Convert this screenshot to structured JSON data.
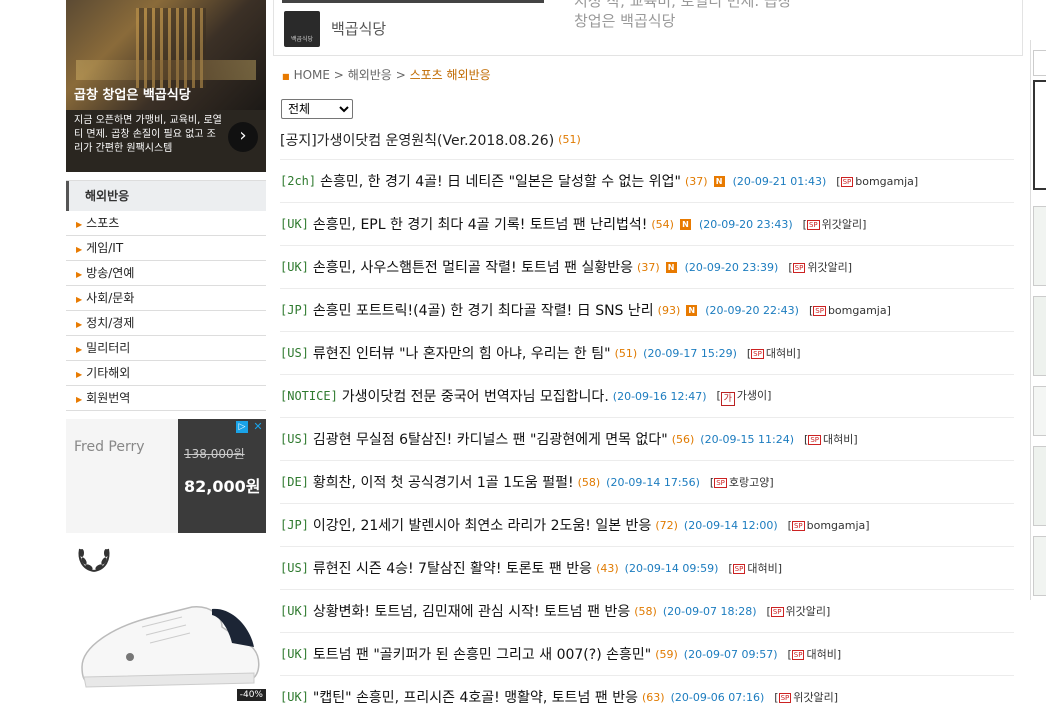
{
  "promo": {
    "title": "곱창 창업은 백곱식당",
    "desc": "지금 오픈하면 가맹비, 교육비, 로열티 면제. 곱창 손질이 필요 없고 조리가 간편한 원팩시스템",
    "arrow": "›"
  },
  "side_nav": {
    "title": "해외반응",
    "items": [
      "스포츠",
      "게임/IT",
      "방송/연예",
      "사회/문화",
      "정치/경제",
      "밀리터리",
      "기타해외",
      "회원번역"
    ]
  },
  "ad": {
    "brand": "Fred Perry",
    "old_price": "138,000원",
    "new_price": "82,000원",
    "discount": "-40%",
    "adchoice": "▷",
    "close": "✕"
  },
  "top_card": {
    "name": "백곱식당",
    "cut_text": "지정 작, 교육비, 로열티 면제. 곱창",
    "sub": "창업은 백곱식당",
    "thumb_label": "백곱식당"
  },
  "breadcrumb": {
    "home": "HOME",
    "sep1": ">",
    "level1": "해외반응",
    "sep2": ">",
    "current": "스포츠 해외반응"
  },
  "filter": {
    "selected": "전체"
  },
  "notice": {
    "title": "[공지]가생이닷컴 운영원칙(Ver.2018.08.26)",
    "count": "(51)"
  },
  "posts": [
    {
      "tag": "[2ch]",
      "title": "손흥민, 한 경기 4골! 日 네티즌 \"일본은 달성할 수 없는 위업\"",
      "count": "(37)",
      "new": true,
      "date": "(20-09-21 01:43)",
      "author": "bomgamja",
      "icon": "sp"
    },
    {
      "tag": "[UK]",
      "title": "손흥민, EPL 한 경기 최다 4골 기록! 토트넘 팬 난리법석!",
      "count": "(54)",
      "new": true,
      "date": "(20-09-20 23:43)",
      "author": "위갓알리",
      "icon": "sp"
    },
    {
      "tag": "[UK]",
      "title": "손흥민, 사우스햄튼전 멀티골 작렬! 토트넘 팬 실황반응",
      "count": "(37)",
      "new": true,
      "date": "(20-09-20 23:39)",
      "author": "위갓알리",
      "icon": "sp"
    },
    {
      "tag": "[JP]",
      "title": "손흥민 포트트릭!(4골) 한 경기 최다골 작렬! 日 SNS 난리",
      "count": "(93)",
      "new": true,
      "date": "(20-09-20 22:43)",
      "author": "bomgamja",
      "icon": "sp"
    },
    {
      "tag": "[US]",
      "title": "류현진 인터뷰 \"나 혼자만의 힘 아냐, 우리는 한 팀\"",
      "count": "(51)",
      "new": false,
      "date": "(20-09-17 15:29)",
      "author": "대혀비",
      "icon": "sp"
    },
    {
      "tag": "[NOTICE]",
      "title": "가생이닷컴 전문 중국어 번역자님 모집합니다.",
      "count": "",
      "new": false,
      "date": "(20-09-16 12:47)",
      "author": "가생이",
      "icon": "g"
    },
    {
      "tag": "[US]",
      "title": "김광현 무실점 6탈삼진! 카디널스 팬 \"김광현에게 면목 없다\"",
      "count": "(56)",
      "new": false,
      "date": "(20-09-15 11:24)",
      "author": "대혀비",
      "icon": "sp"
    },
    {
      "tag": "[DE]",
      "title": "황희찬, 이적 첫 공식경기서 1골 1도움 펄펄!",
      "count": "(58)",
      "new": false,
      "date": "(20-09-14 17:56)",
      "author": "호랑고양",
      "icon": "sp"
    },
    {
      "tag": "[JP]",
      "title": "이강인, 21세기 발렌시아 최연소 라리가 2도움! 일본 반응",
      "count": "(72)",
      "new": false,
      "date": "(20-09-14 12:00)",
      "author": "bomgamja",
      "icon": "sp"
    },
    {
      "tag": "[US]",
      "title": "류현진 시즌 4승! 7탈삼진 활약! 토론토 팬 반응",
      "count": "(43)",
      "new": false,
      "date": "(20-09-14 09:59)",
      "author": "대혀비",
      "icon": "sp"
    },
    {
      "tag": "[UK]",
      "title": "상황변화! 토트넘, 김민재에 관심 시작! 토트넘 팬 반응",
      "count": "(58)",
      "new": false,
      "date": "(20-09-07 18:28)",
      "author": "위갓알리",
      "icon": "sp"
    },
    {
      "tag": "[UK]",
      "title": "토트넘 팬 \"골키퍼가 된 손흥민 그리고 새 007(?) 손흥민\"",
      "count": "(59)",
      "new": false,
      "date": "(20-09-07 09:57)",
      "author": "대혀비",
      "icon": "sp"
    },
    {
      "tag": "[UK]",
      "title": "\"캡틴\" 손흥민, 프리시즌 4호골! 맹활약, 토트넘 팬 반응",
      "count": "(63)",
      "new": false,
      "date": "(20-09-06 07:16)",
      "author": "위갓알리",
      "icon": "sp"
    }
  ],
  "labels": {
    "new_badge": "N",
    "sp_badge": "SP",
    "g_badge": "가"
  },
  "colors": {
    "tag": "#2f7a2f",
    "count": "#e07a00",
    "date": "#1c7cbf",
    "accent": "#e87a00"
  }
}
